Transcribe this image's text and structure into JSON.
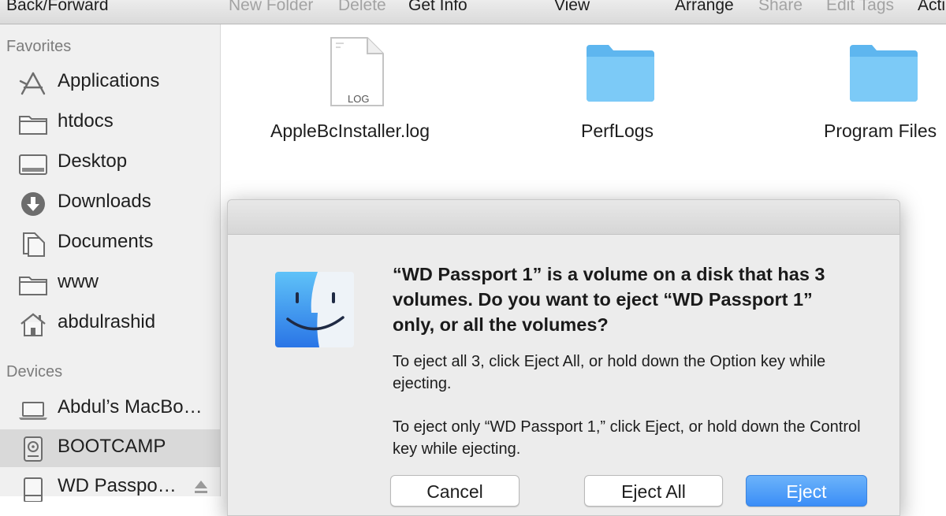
{
  "toolbar": {
    "items": [
      {
        "label": "Back/Forward",
        "enabled": true
      },
      {
        "label": "New Folder",
        "enabled": false
      },
      {
        "label": "Delete",
        "enabled": false
      },
      {
        "label": "Get Info",
        "enabled": true
      },
      {
        "label": "View",
        "enabled": true
      },
      {
        "label": "Arrange",
        "enabled": true
      },
      {
        "label": "Share",
        "enabled": false
      },
      {
        "label": "Edit Tags",
        "enabled": false
      },
      {
        "label": "Acti",
        "enabled": true
      }
    ]
  },
  "sidebar": {
    "favorites_heading": "Favorites",
    "favorites": [
      {
        "label": "Applications",
        "icon": "applications-icon"
      },
      {
        "label": "htdocs",
        "icon": "folder-icon"
      },
      {
        "label": "Desktop",
        "icon": "desktop-icon"
      },
      {
        "label": "Downloads",
        "icon": "downloads-icon"
      },
      {
        "label": "Documents",
        "icon": "documents-icon"
      },
      {
        "label": "www",
        "icon": "folder-icon"
      },
      {
        "label": "abdulrashid",
        "icon": "home-icon"
      }
    ],
    "devices_heading": "Devices",
    "devices": [
      {
        "label": "Abdul’s MacBo…",
        "icon": "laptop-icon",
        "selected": false
      },
      {
        "label": "BOOTCAMP",
        "icon": "hard-disk-icon",
        "selected": true
      },
      {
        "label": "WD Passpo…",
        "icon": "external-disk-icon",
        "selected": false,
        "eject": true
      }
    ]
  },
  "files": [
    {
      "name": "AppleBcInstaller.log",
      "kind": "log",
      "badge": "LOG"
    },
    {
      "name": "PerfLogs",
      "kind": "folder"
    },
    {
      "name": "Program Files",
      "kind": "folder"
    }
  ],
  "dialog": {
    "title": "“WD Passport 1” is a volume on a disk that has 3 volumes. Do you want to eject “WD Passport 1” only, or all the volumes?",
    "message1": "To eject all 3, click Eject All, or hold down the Option key while ejecting.",
    "message2": "To eject only “WD Passport 1,” click Eject, or hold down the Control key while ejecting.",
    "buttons": {
      "cancel": "Cancel",
      "eject_all": "Eject All",
      "eject": "Eject"
    }
  },
  "colors": {
    "accent": "#3b8ef7",
    "folder": "#6ec3f5",
    "sidebar_bg": "#f0f0f0",
    "selected_row": "#d9d9d9"
  }
}
